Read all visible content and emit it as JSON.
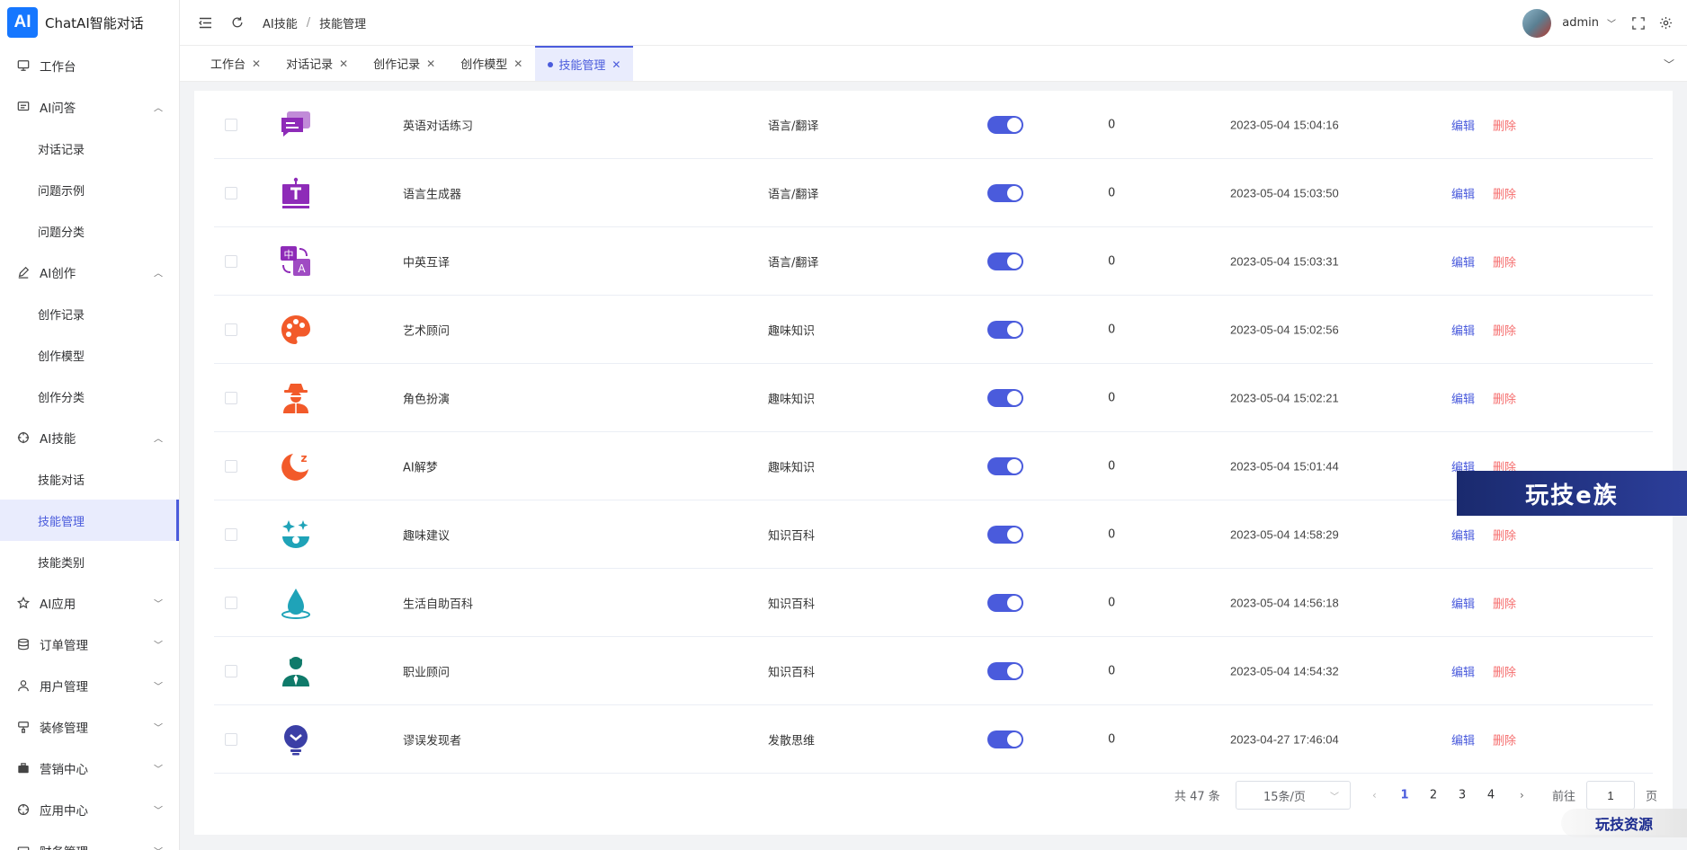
{
  "app": {
    "logo": "AI",
    "title": "ChatAI智能对话"
  },
  "sidebar": {
    "items": [
      {
        "label": "工作台",
        "icon": "monitor-icon"
      },
      {
        "label": "AI问答",
        "icon": "message-icon",
        "expanded": true,
        "children": [
          "对话记录",
          "问题示例",
          "问题分类"
        ]
      },
      {
        "label": "AI创作",
        "icon": "pen-icon",
        "expanded": true,
        "children": [
          "创作记录",
          "创作模型",
          "创作分类"
        ]
      },
      {
        "label": "AI技能",
        "icon": "aim-icon",
        "expanded": true,
        "children": [
          "技能对话",
          "技能管理",
          "技能类别"
        ],
        "active_child": "技能管理"
      },
      {
        "label": "AI应用",
        "icon": "star-icon",
        "expanded": false
      },
      {
        "label": "订单管理",
        "icon": "database-icon",
        "expanded": false
      },
      {
        "label": "用户管理",
        "icon": "user-icon",
        "expanded": false
      },
      {
        "label": "装修管理",
        "icon": "brush-icon",
        "expanded": false
      },
      {
        "label": "营销中心",
        "icon": "briefcase-icon",
        "expanded": false
      },
      {
        "label": "应用中心",
        "icon": "compass-icon",
        "expanded": false
      },
      {
        "label": "财务管理",
        "icon": "wallet-icon",
        "expanded": false
      }
    ]
  },
  "header": {
    "breadcrumb": [
      "AI技能",
      "技能管理"
    ],
    "user": "admin"
  },
  "tabs": [
    {
      "label": "工作台",
      "active": false
    },
    {
      "label": "对话记录",
      "active": false
    },
    {
      "label": "创作记录",
      "active": false
    },
    {
      "label": "创作模型",
      "active": false
    },
    {
      "label": "技能管理",
      "active": true
    }
  ],
  "table": {
    "rows": [
      {
        "icon": "chat-bubbles-icon",
        "color": "#8e2bb8",
        "name": "英语对话练习",
        "category": "语言/翻译",
        "enabled": true,
        "count": "0",
        "time": "2023-05-04 15:04:16"
      },
      {
        "icon": "text-board-icon",
        "color": "#8e2bb8",
        "name": "语言生成器",
        "category": "语言/翻译",
        "enabled": true,
        "count": "0",
        "time": "2023-05-04 15:03:50"
      },
      {
        "icon": "translate-icon",
        "color": "#8e2bb8",
        "name": "中英互译",
        "category": "语言/翻译",
        "enabled": true,
        "count": "0",
        "time": "2023-05-04 15:03:31"
      },
      {
        "icon": "palette-icon",
        "color": "#f25a2a",
        "name": "艺术顾问",
        "category": "趣味知识",
        "enabled": true,
        "count": "0",
        "time": "2023-05-04 15:02:56"
      },
      {
        "icon": "spy-icon",
        "color": "#f25a2a",
        "name": "角色扮演",
        "category": "趣味知识",
        "enabled": true,
        "count": "0",
        "time": "2023-05-04 15:02:21"
      },
      {
        "icon": "moon-sleep-icon",
        "color": "#f25a2a",
        "name": "AI解梦",
        "category": "趣味知识",
        "enabled": true,
        "count": "0",
        "time": "2023-05-04 15:01:44"
      },
      {
        "icon": "sparkle-bowl-icon",
        "color": "#1fa3b8",
        "name": "趣味建议",
        "category": "知识百科",
        "enabled": true,
        "count": "0",
        "time": "2023-05-04 14:58:29"
      },
      {
        "icon": "water-drop-icon",
        "color": "#1fa3b8",
        "name": "生活自助百科",
        "category": "知识百科",
        "enabled": true,
        "count": "0",
        "time": "2023-05-04 14:56:18"
      },
      {
        "icon": "businessman-icon",
        "color": "#0f7a6a",
        "name": "职业顾问",
        "category": "知识百科",
        "enabled": true,
        "count": "0",
        "time": "2023-05-04 14:54:32"
      },
      {
        "icon": "lightbulb-icon",
        "color": "#3b3fa6",
        "name": "谬误发现者",
        "category": "发散思维",
        "enabled": true,
        "count": "0",
        "time": "2023-04-27 17:46:04"
      }
    ],
    "edit_label": "编辑",
    "delete_label": "删除"
  },
  "pagination": {
    "total": "共 47 条",
    "page_size": "15条/页",
    "pages": [
      "1",
      "2",
      "3",
      "4"
    ],
    "current": "1",
    "goto_label": "前往",
    "goto_value": "1",
    "page_word": "页"
  },
  "watermarks": {
    "top": "玩技e族",
    "bottom": "玩技资源"
  },
  "colors": {
    "primary": "#4a5bdc",
    "danger": "#f56c6c",
    "logo": "#1677ff"
  }
}
